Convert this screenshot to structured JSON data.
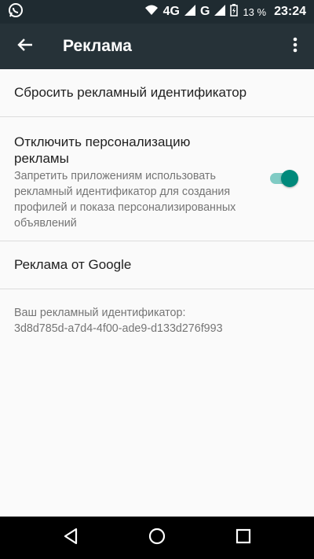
{
  "status_bar": {
    "network_label": "4G",
    "network2_label": "G",
    "battery_percent": "13 %",
    "time": "23:24",
    "icons": [
      "whatsapp-icon",
      "wifi-icon",
      "signal-icon",
      "battery-icon"
    ]
  },
  "toolbar": {
    "title": "Реклама",
    "back_icon": "arrow-back-icon",
    "more_icon": "more-vert-icon"
  },
  "settings": {
    "reset_label": "Сбросить рекламный идентификатор",
    "personalization": {
      "title": "Отключить персонализацию рекламы",
      "summary": "Запретить приложениям использовать рекламный идентификатор для создания профилей и показа персонализированных объявлений",
      "enabled": true
    },
    "google_ads_label": "Реклама от Google",
    "ad_id_label": "Ваш рекламный идентификатор:",
    "ad_id_value": "3d8d785d-a7d4-4f00-ade9-d133d276f993"
  },
  "colors": {
    "status_bar_bg": "#1f2b31",
    "toolbar_bg": "#263238",
    "accent": "#00897b",
    "track": "#80cbc4"
  }
}
